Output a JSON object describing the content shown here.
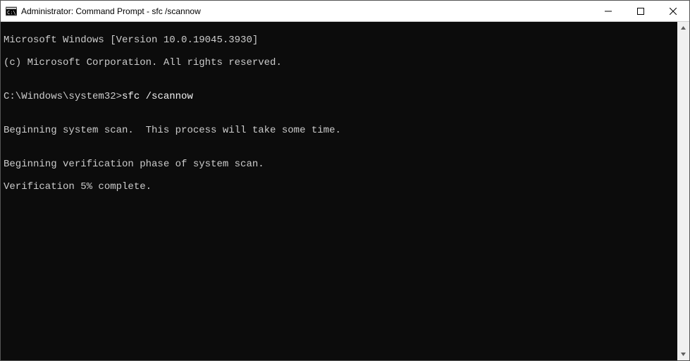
{
  "titlebar": {
    "title": "Administrator: Command Prompt - sfc  /scannow"
  },
  "terminal": {
    "line1": "Microsoft Windows [Version 10.0.19045.3930]",
    "line2": "(c) Microsoft Corporation. All rights reserved.",
    "blank1": "",
    "prompt_path": "C:\\Windows\\system32>",
    "prompt_command": "sfc /scannow",
    "blank2": "",
    "line3": "Beginning system scan.  This process will take some time.",
    "blank3": "",
    "line4": "Beginning verification phase of system scan.",
    "line5": "Verification 5% complete."
  }
}
